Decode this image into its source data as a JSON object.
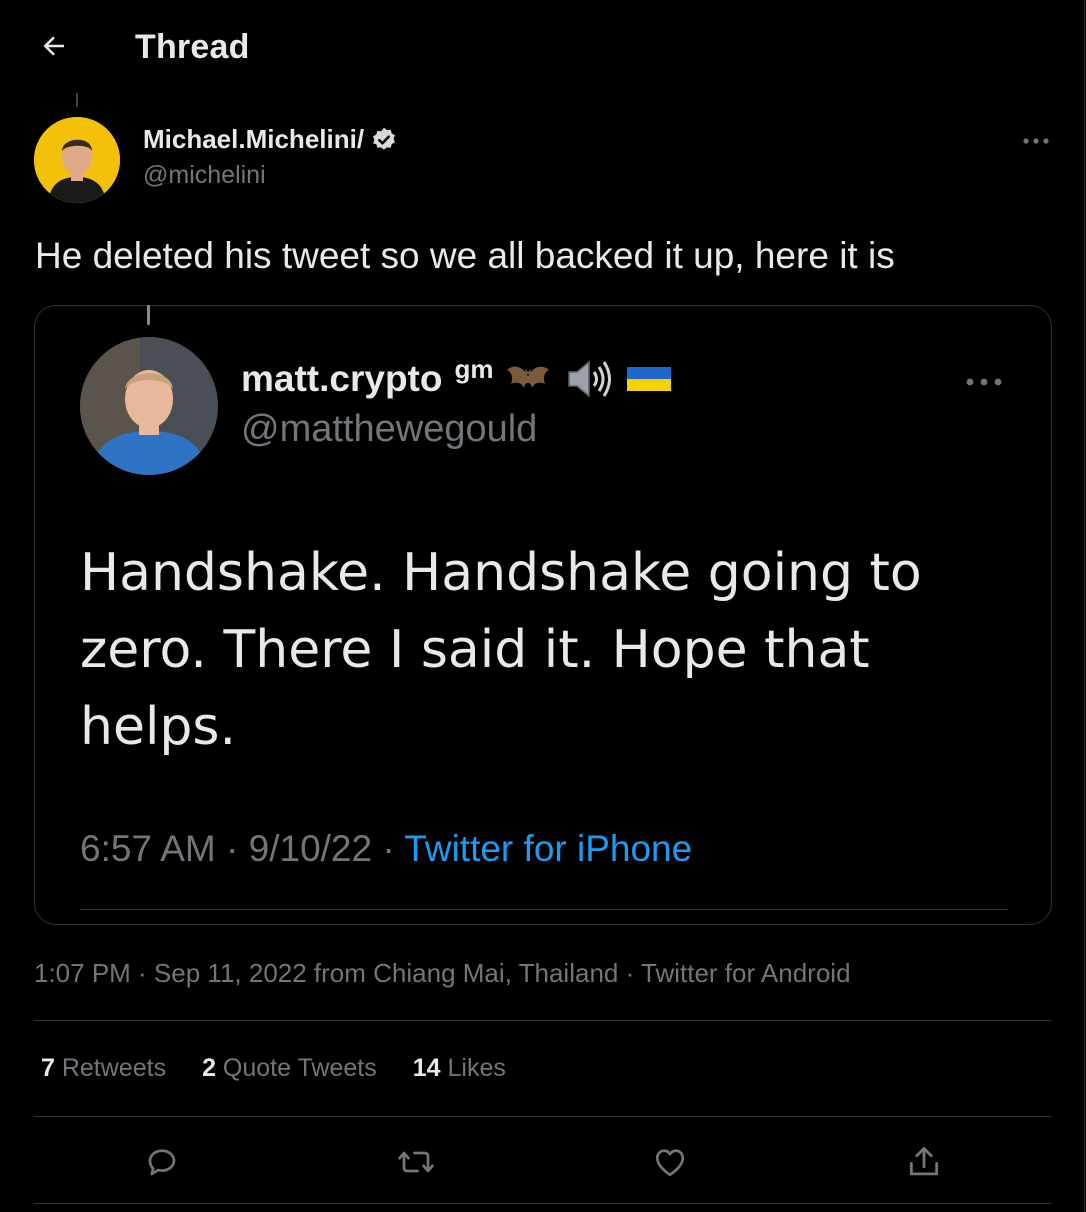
{
  "header": {
    "title": "Thread"
  },
  "tweet": {
    "author_name": "Michael.Michelini/",
    "author_handle": "@michelini",
    "text": "He deleted his tweet so we all backed it up, here it is",
    "timestamp": "1:07 PM · Sep 11, 2022 from Chiang Mai, Thailand · Twitter for Android"
  },
  "quoted": {
    "author_name": "matt.crypto",
    "name_suffix": "gm",
    "emojis": [
      "🦇",
      "🔊",
      "🇺🇦"
    ],
    "author_handle": "@matthewegould",
    "text_lines": [
      "Handshake. Handshake going to",
      "zero. There I said it. Hope that",
      "helps."
    ],
    "time": "6:57 AM · 9/10/22 · ",
    "source": "Twitter for iPhone"
  },
  "stats": {
    "retweets_count": "7",
    "retweets_label": " Retweets",
    "quotes_count": "2",
    "quotes_label": " Quote Tweets",
    "likes_count": "14",
    "likes_label": " Likes"
  },
  "colors": {
    "background": "#000000",
    "text": "#e7e9ea",
    "muted": "#71767b",
    "link": "#1d9bf0",
    "border": "#2f3336"
  },
  "icons": [
    "back-arrow-icon",
    "verified-badge-icon",
    "more-icon",
    "reply-icon",
    "retweet-icon",
    "like-icon",
    "share-icon"
  ]
}
